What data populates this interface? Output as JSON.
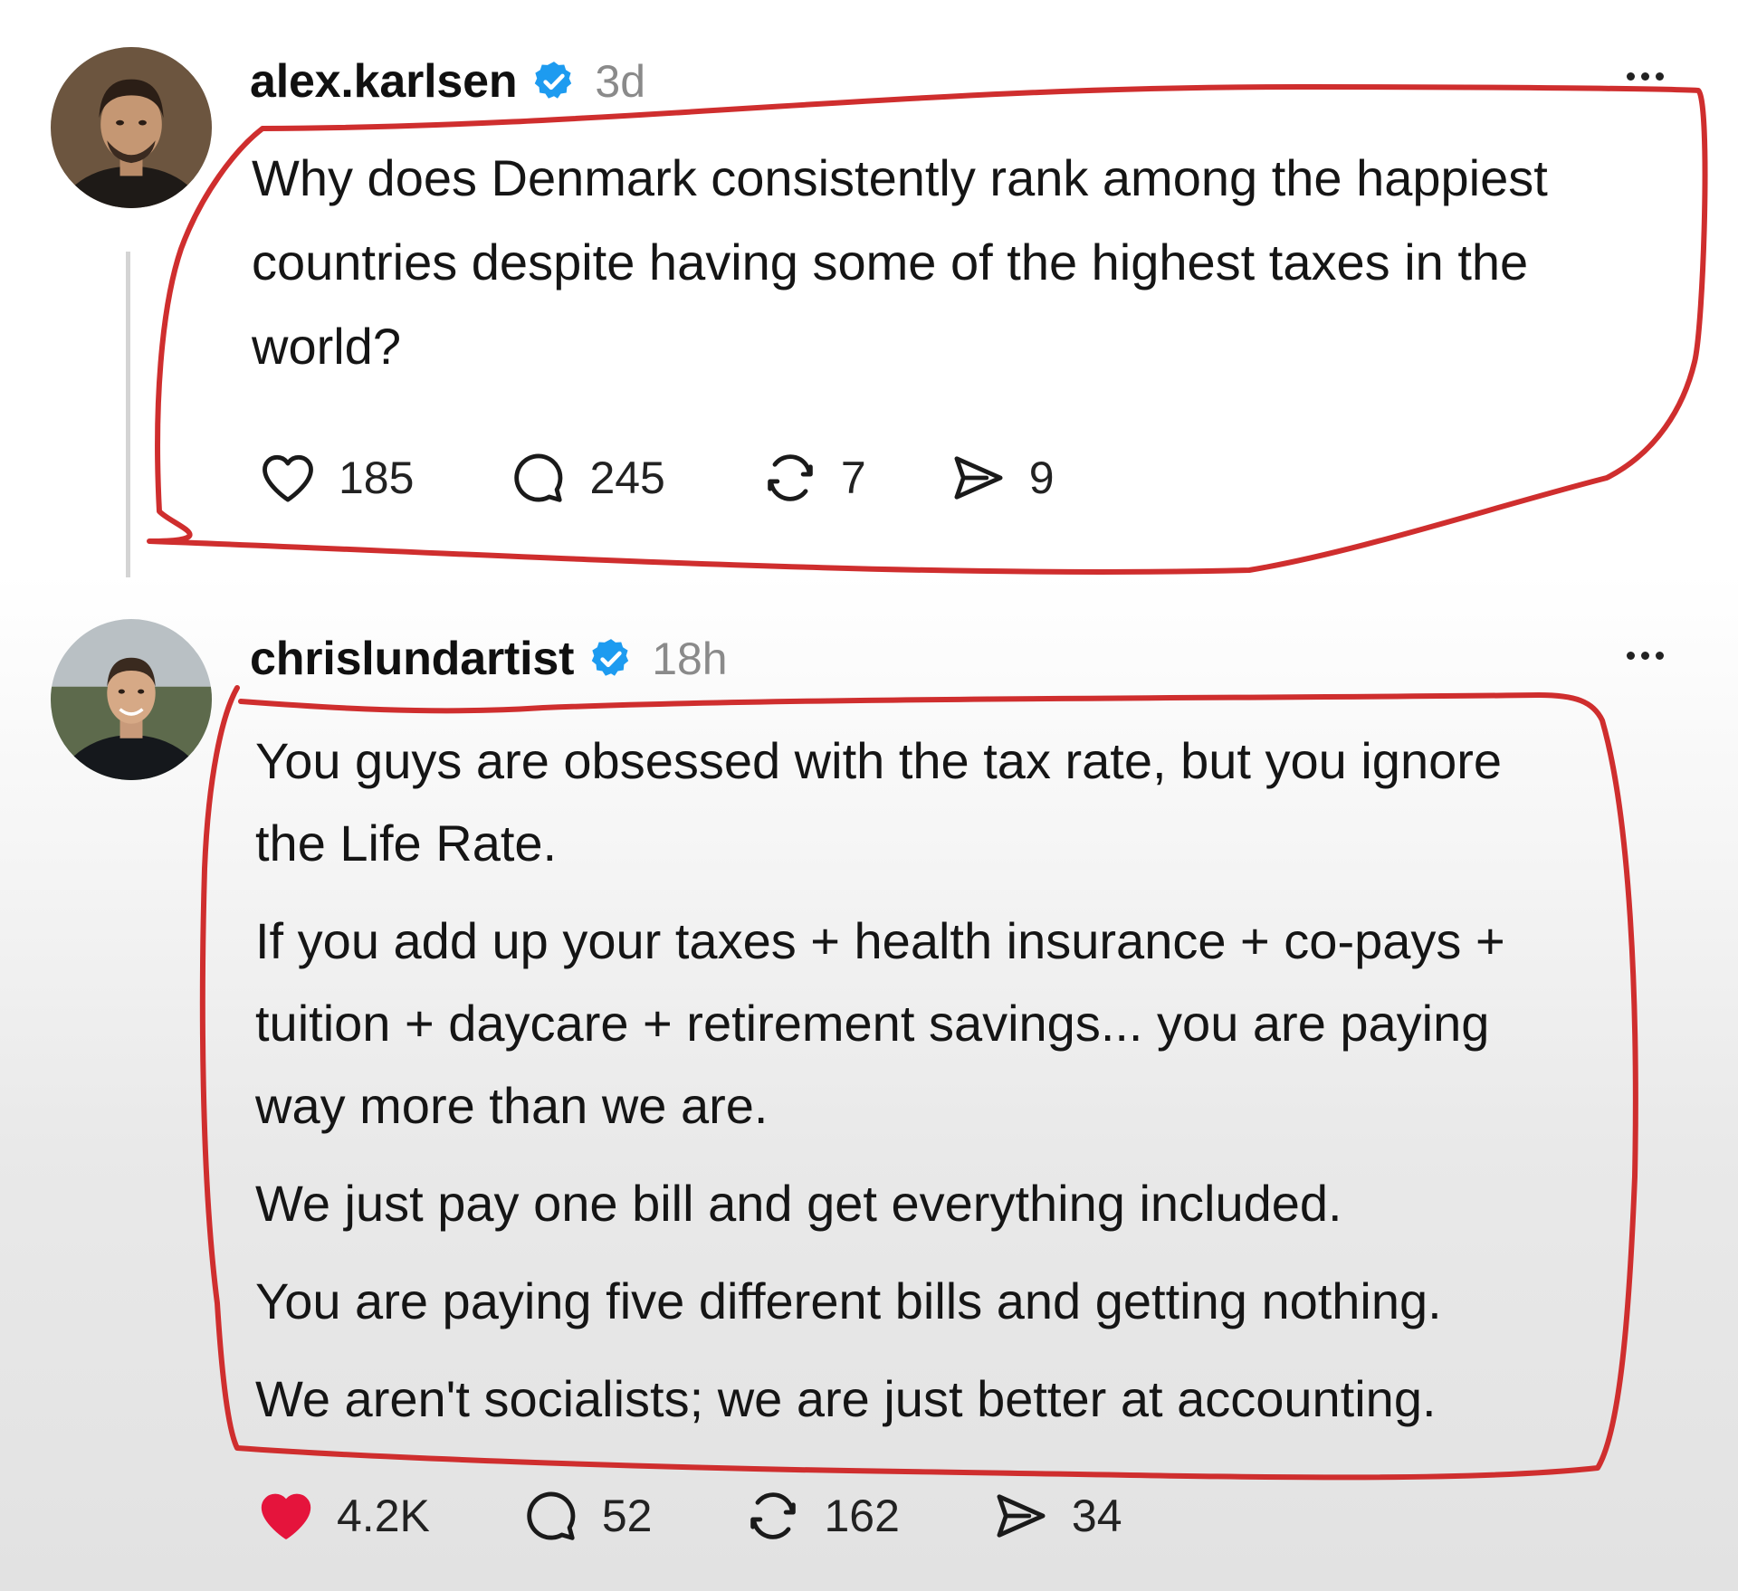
{
  "posts": [
    {
      "username": "alex.karlsen",
      "verified": true,
      "time": "3d",
      "text_lines": [
        "Why does Denmark consistently rank among the happiest",
        "countries despite having some of the highest taxes in the",
        "world?"
      ],
      "actions": {
        "likes": "185",
        "replies": "245",
        "reposts": "7",
        "shares": "9"
      },
      "liked": false
    },
    {
      "username": "chrislundartist",
      "verified": true,
      "time": "18h",
      "paragraphs": [
        [
          "You guys are obsessed with the tax rate, but you ignore",
          "the Life Rate."
        ],
        [
          "If you add up your taxes + health insurance + co-pays +",
          "tuition + daycare + retirement savings... you are paying",
          "way more than we are."
        ],
        [
          "We just pay one bill and get everything included."
        ],
        [
          "You are paying five different bills and getting nothing."
        ],
        [
          "We aren't socialists; we are just better at accounting."
        ]
      ],
      "actions": {
        "likes": "4.2K",
        "replies": "52",
        "reposts": "162",
        "shares": "34"
      },
      "liked": true
    }
  ],
  "icons": {
    "verified": "verified-badge-icon",
    "like": "heart-icon",
    "reply": "speech-bubble-icon",
    "repost": "repost-arrows-icon",
    "share": "send-icon",
    "more": "more-dots-icon"
  },
  "colors": {
    "verified_badge": "#1d9bf0",
    "liked_heart": "#e5143c",
    "annotation": "#cf2e2e",
    "timestamp": "#8a8a8a"
  }
}
